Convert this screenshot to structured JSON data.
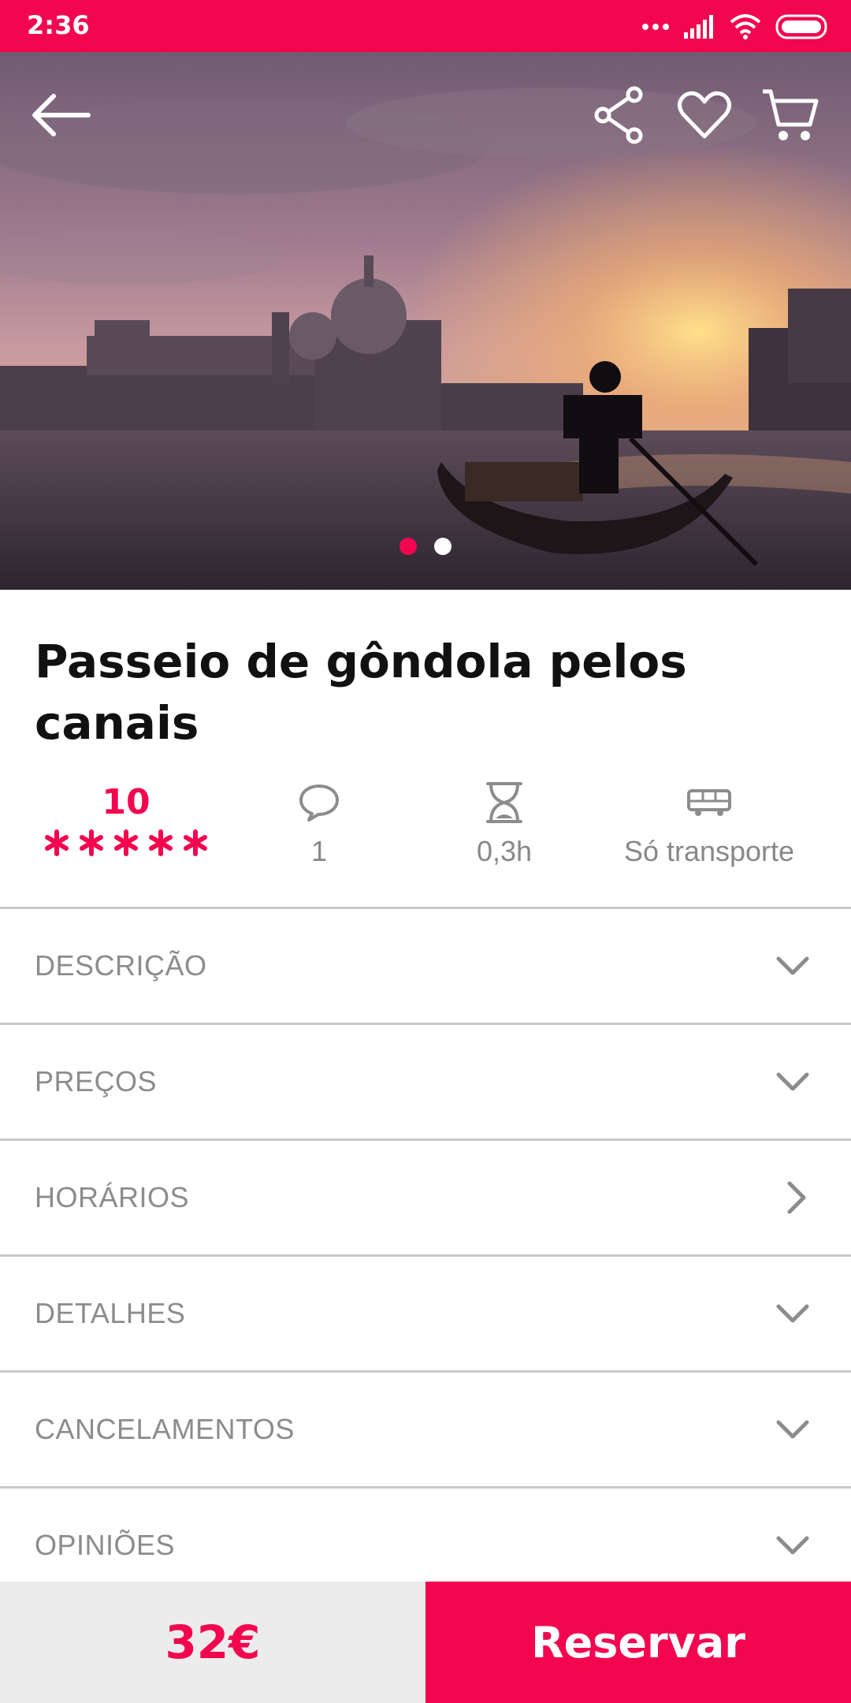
{
  "status_bar": {
    "time": "2:36"
  },
  "hero": {
    "image_description": "gondola-at-sunset",
    "carousel": {
      "total": 2,
      "active": 0
    }
  },
  "title": "Passeio de gôndola pelos canais",
  "stats": {
    "rating": "10",
    "stars": 5,
    "comments": "1",
    "duration": "0,3h",
    "transport": "Só transporte"
  },
  "sections": [
    {
      "label": "DESCRIÇÃO",
      "icon": "chevron-down-icon"
    },
    {
      "label": "PREÇOS",
      "icon": "chevron-down-icon"
    },
    {
      "label": "HORÁRIOS",
      "icon": "chevron-right-icon"
    },
    {
      "label": "DETALHES",
      "icon": "chevron-down-icon"
    },
    {
      "label": "CANCELAMENTOS",
      "icon": "chevron-down-icon"
    },
    {
      "label": "OPINIÕES",
      "icon": "chevron-down-icon"
    }
  ],
  "bottom_bar": {
    "price": "32€",
    "reserve_label": "Reservar"
  },
  "colors": {
    "accent": "#f2074f",
    "muted_text": "#8c8c8c",
    "divider": "#c8c8c8"
  }
}
